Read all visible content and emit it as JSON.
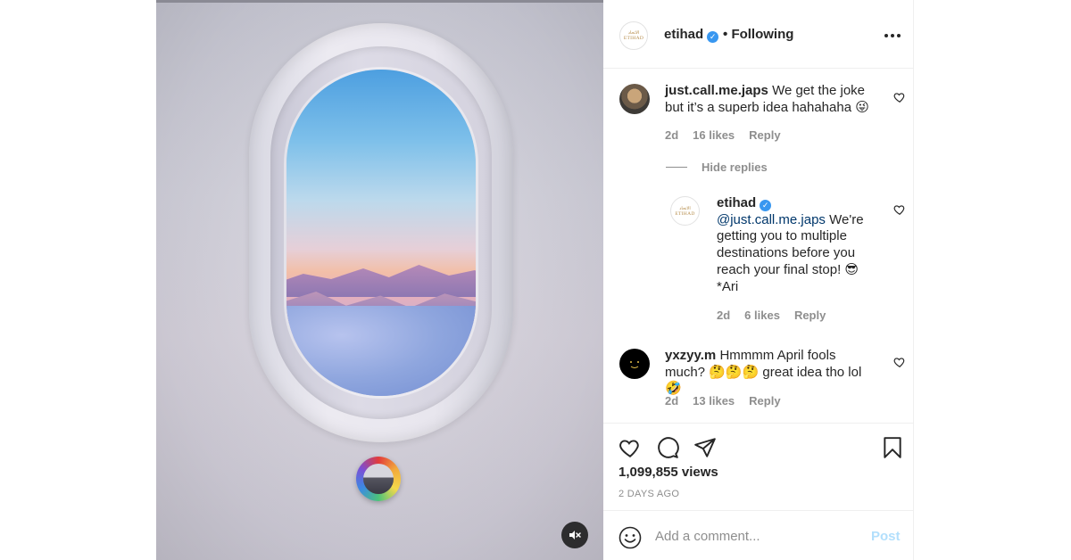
{
  "post": {
    "views": "1,099,855 views",
    "time_ago": "2 DAYS AGO"
  },
  "header": {
    "username": "etihad",
    "separator": "•",
    "follow_status": "Following",
    "avatar_logo_arabic": "الاتحاد",
    "avatar_logo_latin": "ETIHAD",
    "more_icon": "more-horizontal-icon"
  },
  "comments": [
    {
      "username": "just.call.me.japs",
      "text": "We get the joke but it’s a superb idea hahahaha 😜",
      "time": "2d",
      "likes": "16 likes",
      "reply": "Reply"
    },
    {
      "username": "yxzyy.m",
      "text": "Hmmmm April fools much? 🤔🤔🤔 great idea tho lol 🤣",
      "time": "2d",
      "likes": "13 likes",
      "reply": "Reply"
    }
  ],
  "hide_replies": "Hide replies",
  "reply": {
    "username": "etihad",
    "mention": "@just.call.me.japs",
    "text": " We're getting you to multiple destinations before you reach your final stop! 😎 *Ari",
    "time": "2d",
    "likes": "6 likes",
    "reply": "Reply"
  },
  "composer": {
    "placeholder": "Add a comment...",
    "post_label": "Post"
  },
  "colors": {
    "verified_blue": "#3897f0",
    "post_disabled": "#b2dffc",
    "meta_gray": "#8e8e8e"
  }
}
